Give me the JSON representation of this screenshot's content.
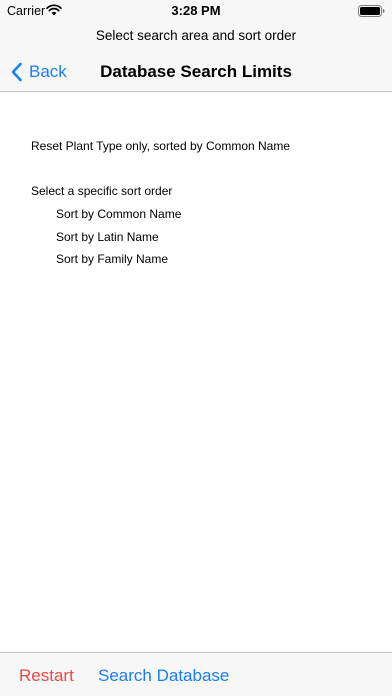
{
  "status_bar": {
    "carrier": "Carrier",
    "time": "3:28 PM",
    "wifi_icon": "wifi-icon",
    "battery_icon": "battery-icon"
  },
  "nav": {
    "prompt": "Select search area and sort order",
    "back_label": "Back",
    "back_icon": "chevron-left-icon",
    "title": "Database Search Limits"
  },
  "content": {
    "reset_option": "Reset Plant Type only, sorted by Common Name",
    "sort_header": "Select a specific sort order",
    "sort_options": [
      "Sort by Common Name",
      "Sort by Latin Name",
      "Sort by Family Name"
    ]
  },
  "toolbar": {
    "restart_label": "Restart",
    "search_label": "Search Database"
  },
  "colors": {
    "accent": "#1a7ff0",
    "destructive": "#ea4a48",
    "bar_background": "#f7f7f7"
  }
}
